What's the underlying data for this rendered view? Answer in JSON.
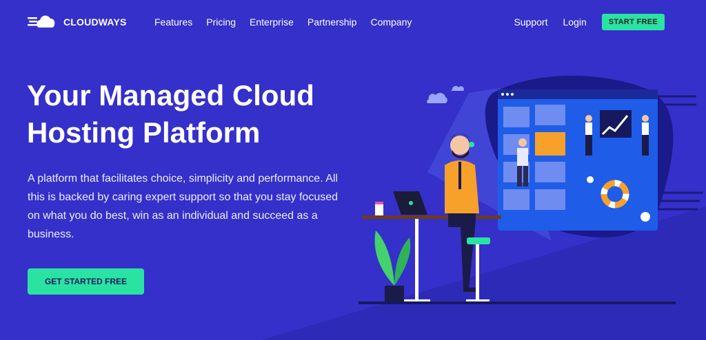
{
  "brand": {
    "name": "CLOUDWAYS",
    "logo_icon": "cloud-icon"
  },
  "nav": {
    "links": [
      "Features",
      "Pricing",
      "Enterprise",
      "Partnership",
      "Company"
    ],
    "support": "Support",
    "login": "Login",
    "start_free": "START FREE"
  },
  "hero": {
    "title_line1": "Your Managed Cloud",
    "title_line2": "Hosting Platform",
    "description": "A platform that facilitates choice, simplicity and performance. All this is backed by caring expert support so that you stay focused on what you do best, win as an individual and succeed as a business.",
    "cta": "GET STARTED FREE"
  },
  "colors": {
    "background": "#3530c9",
    "accent": "#2ae3a3",
    "panel": "#1f5de8",
    "shirt": "#f7a12b"
  }
}
